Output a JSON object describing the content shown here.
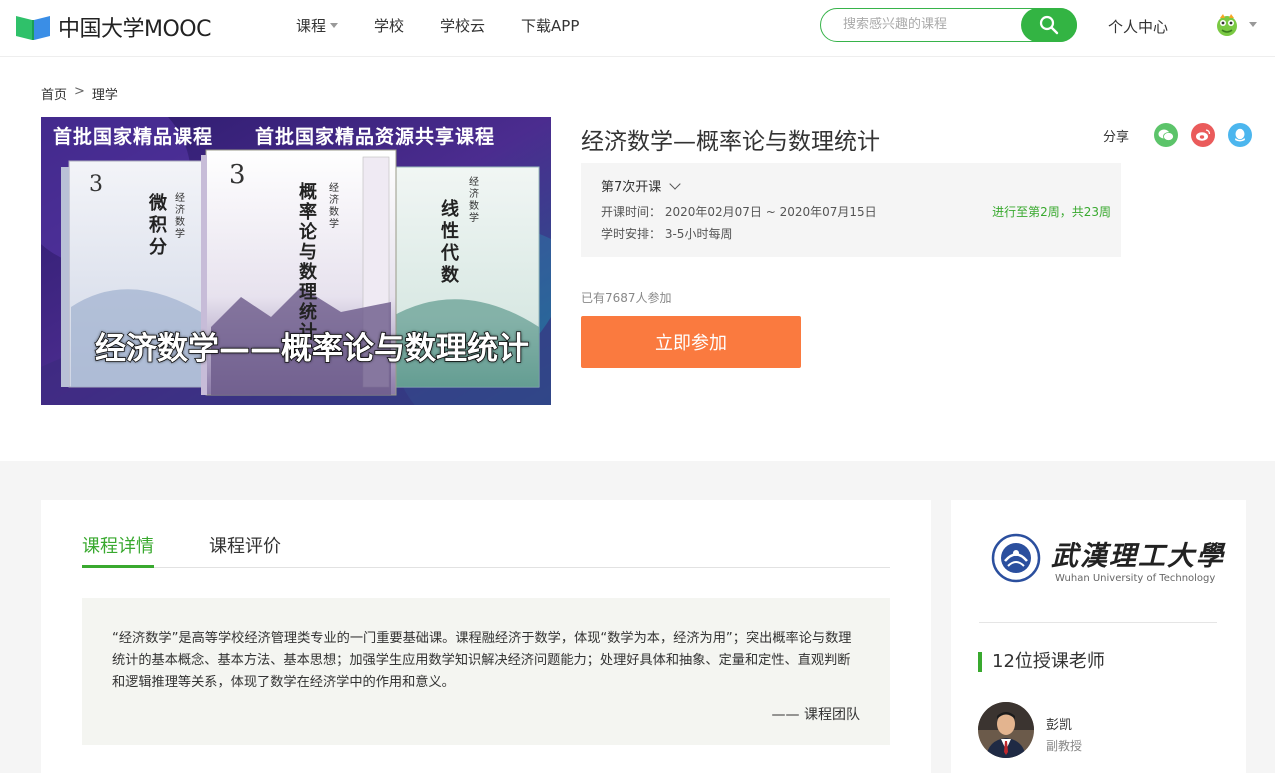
{
  "header": {
    "logo_text": "中国大学MOOC",
    "nav": [
      {
        "label": "课程",
        "dropdown": true
      },
      {
        "label": "学校"
      },
      {
        "label": "学校云"
      },
      {
        "label": "下载APP"
      }
    ],
    "search_placeholder": "搜索感兴趣的课程",
    "personal_center": "个人中心",
    "accent": "#33b443"
  },
  "breadcrumb": [
    "首页",
    ">",
    "理学"
  ],
  "cover": {
    "banner_left": "首批国家精品课程",
    "banner_right": "首批国家精品资源共享课程",
    "book1_title": "微积分",
    "book2_title": "概率论与数理统计",
    "book3_title": "线性代数",
    "series": "经济数学",
    "edition": "3",
    "big_caption": "经济数学——概率论与数理统计"
  },
  "course": {
    "title": "经济数学—概率论与数理统计",
    "share_label": "分享",
    "term": "第7次开课",
    "date_label": "开课时间：",
    "date_value": "2020年02月07日 ~ 2020年07月15日",
    "hours_label": "学时安排：",
    "hours_value": "3-5小时每周",
    "progress": "进行至第2周，共23周",
    "joined": "已有7687人参加",
    "join_button": "立即参加",
    "join_color": "#fa7a3f"
  },
  "tabs": [
    {
      "label": "课程详情",
      "active": true
    },
    {
      "label": "课程评价",
      "active": false
    }
  ],
  "intro": {
    "text": "“经济数学”是高等学校经济管理类专业的一门重要基础课。课程融经济于数学，体现“数学为本，经济为用”；突出概率论与数理统计的基本概念、基本方法、基本思想；加强学生应用数学知识解决经济问题能力；处理好具体和抽象、定量和定性、直观判断和逻辑推理等关系，体现了数学在经济学中的作用和意义。",
    "signature": "—— 课程团队"
  },
  "school": {
    "name_cn": "武漢理工大學",
    "name_en": "Wuhan University of Technology"
  },
  "teachers": {
    "heading": "12位授课老师",
    "list": [
      {
        "name": "彭凯",
        "rank": "副教授"
      }
    ]
  }
}
